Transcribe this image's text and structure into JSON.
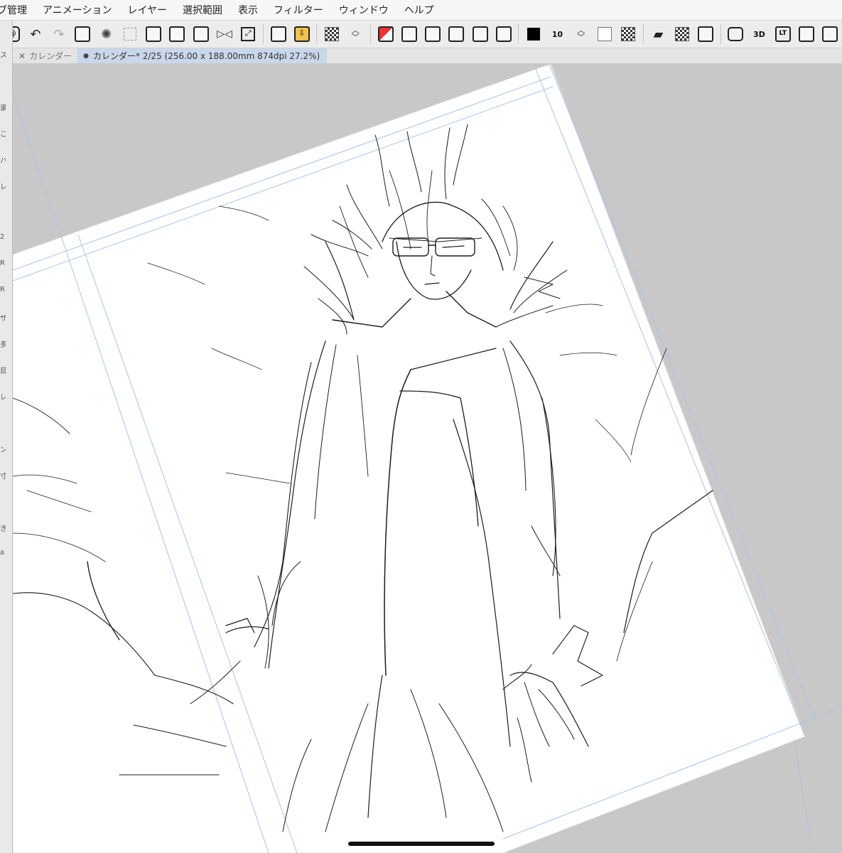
{
  "menu": [
    "ブ管理",
    "アニメーション",
    "レイヤー",
    "選択範囲",
    "表示",
    "フィルター",
    "ウィンドウ",
    "ヘルプ"
  ],
  "toolbar": {
    "icons": [
      "clip-logo-icon",
      "undo-icon",
      "redo-icon",
      "fill-icon",
      "loading-icon",
      "clear-selection-icon",
      "layer-export-icon",
      "layer-icon",
      "selection-icon",
      "flip-icon",
      "transform-icon",
      "import-icon",
      "import-gold-icon",
      "checker-icon",
      "updown-icon",
      "new-layer-red-icon",
      "new-layer-icon",
      "vector-layer-icon",
      "folder-layer-icon",
      "merge-icon",
      "mask-icon",
      "main-color-swatch",
      "brush-size",
      "updown-icon",
      "sub-color-swatch",
      "transparent-icon",
      "open-folder-icon",
      "pattern-icon",
      "cube-icon",
      "cat-icon",
      "3d-icon",
      "lt-icon",
      "tv-icon",
      "pen-icon"
    ],
    "main_color": "#000000",
    "sub_color": "#ffffff",
    "brush_size_label": "10"
  },
  "tabs": [
    {
      "label": "カレンダー",
      "active": false
    },
    {
      "label": "カレンダー* 2/25 (256.00 x 188.00mm 874dpi 27.2%)",
      "active": true
    }
  ],
  "left_panel_fragments": [
    "ス",
    "",
    "录",
    "こ",
    "ハ",
    "レ",
    "",
    "2",
    "R",
    "R",
    "ザ",
    "多",
    "目",
    "レ",
    "",
    "ン",
    "寸",
    "",
    "き",
    "a"
  ],
  "canvas": {
    "rotation_deg": -17,
    "zoom": "27.2%"
  }
}
